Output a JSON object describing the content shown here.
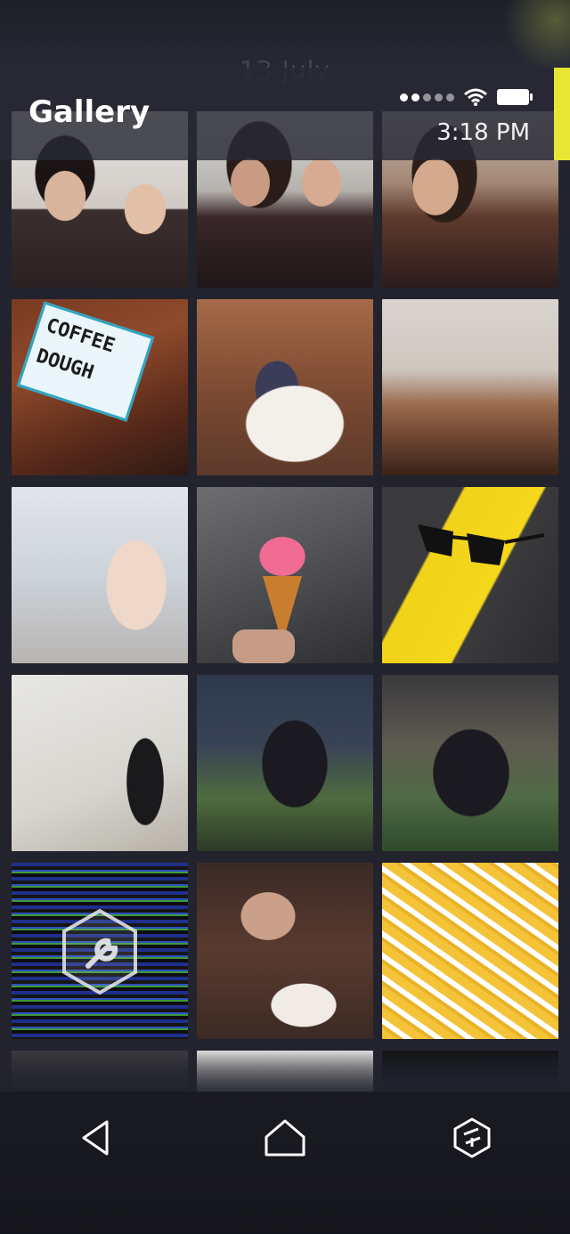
{
  "header": {
    "title": "Gallery",
    "date_label": "13 July",
    "time": "3:18 PM"
  },
  "status_bar": {
    "signal_icon": "signal-dots-icon",
    "wifi_icon": "wifi-icon",
    "battery_icon": "battery-icon"
  },
  "accent_color": "#e8e533",
  "photos": [
    {
      "label": "selfie-1"
    },
    {
      "label": "selfie-2"
    },
    {
      "label": "selfie-3"
    },
    {
      "label": "coffee-sign",
      "sign_lines": [
        "COFFEE",
        "DOUGH"
      ]
    },
    {
      "label": "cake"
    },
    {
      "label": "cafe-interior"
    },
    {
      "label": "macarons"
    },
    {
      "label": "ice-cream"
    },
    {
      "label": "sunglasses-road"
    },
    {
      "label": "woman-by-wall"
    },
    {
      "label": "night-selfie-1"
    },
    {
      "label": "night-selfie-2"
    },
    {
      "label": "glitched-photo",
      "overlay_icon": "repair-wrench-icon"
    },
    {
      "label": "eating"
    },
    {
      "label": "fries"
    },
    {
      "label": "partial-1"
    },
    {
      "label": "partial-2"
    },
    {
      "label": "partial-3"
    }
  ],
  "navbar": {
    "back_icon": "back-triangle-icon",
    "home_icon": "home-icon",
    "apps_icon": "hexagon-switcher-icon"
  }
}
